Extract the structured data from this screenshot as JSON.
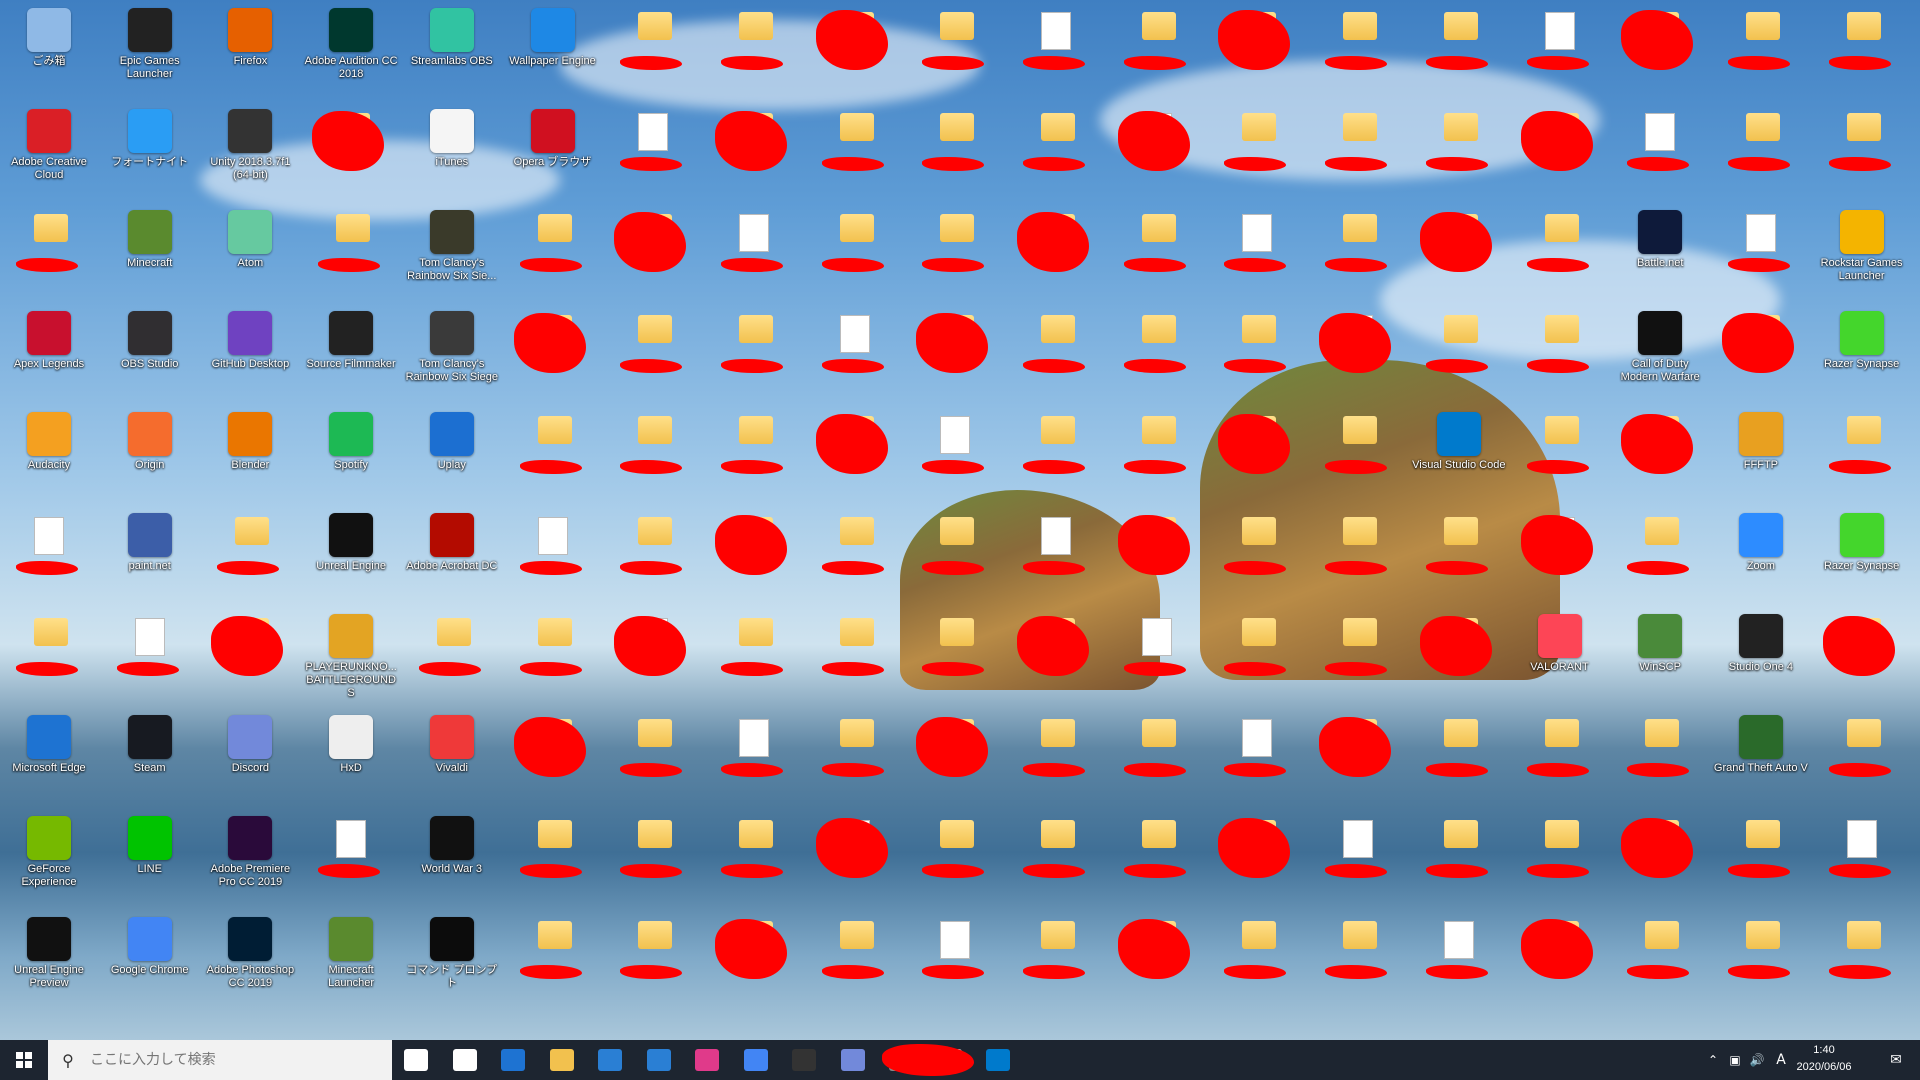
{
  "desktop": {
    "icons": [
      {
        "label": "ごみ箱",
        "icon": "recycle-bin-icon",
        "color": "#8fb9e6"
      },
      {
        "label": "Epic Games Launcher",
        "icon": "epic-games-icon",
        "color": "#222222"
      },
      {
        "label": "Firefox",
        "icon": "firefox-icon",
        "color": "#e66000"
      },
      {
        "label": "Adobe Audition CC 2018",
        "icon": "audition-icon",
        "color": "#00382e"
      },
      {
        "label": "Streamlabs OBS",
        "icon": "streamlabs-icon",
        "color": "#31c3a2"
      },
      {
        "label": "Wallpaper Engine",
        "icon": "wallpaper-engine-icon",
        "color": "#1e88e5"
      },
      {
        "label": "Adobe Creative Cloud",
        "icon": "creative-cloud-icon",
        "color": "#da1f26"
      },
      {
        "label": "フォートナイト",
        "icon": "fortnite-icon",
        "color": "#2a9df4"
      },
      {
        "label": "Unity 2018.3.7f1 (64-bit)",
        "icon": "unity-icon",
        "color": "#333333"
      },
      {
        "label": "iTunes",
        "icon": "itunes-icon",
        "color": "#f5f5f5"
      },
      {
        "label": "Opera ブラウザ",
        "icon": "opera-icon",
        "color": "#d01020"
      },
      {
        "label": "Minecraft",
        "icon": "minecraft-icon",
        "color": "#5a8a2e"
      },
      {
        "label": "Atom",
        "icon": "atom-icon",
        "color": "#66c9a0"
      },
      {
        "label": "Tom Clancy's Rainbow Six Sie...",
        "icon": "rainbow-six-server-icon",
        "color": "#3a3a2a"
      },
      {
        "label": "Battle.net",
        "icon": "battlenet-icon",
        "color": "#0e1a3a"
      },
      {
        "label": "Rockstar Games Launcher",
        "icon": "rockstar-icon",
        "color": "#f4b400"
      },
      {
        "label": "Apex Legends",
        "icon": "apex-icon",
        "color": "#c8102e"
      },
      {
        "label": "OBS Studio",
        "icon": "obs-icon",
        "color": "#302e31"
      },
      {
        "label": "GitHub Desktop",
        "icon": "github-icon",
        "color": "#6f42c1"
      },
      {
        "label": "Source Filmmaker",
        "icon": "sfm-icon",
        "color": "#222222"
      },
      {
        "label": "Tom Clancy's Rainbow Six Siege",
        "icon": "rainbow-six-icon",
        "color": "#3a3a3a"
      },
      {
        "label": "Call of Duty Modern Warfare",
        "icon": "cod-icon",
        "color": "#111111"
      },
      {
        "label": "Razer Synapse",
        "icon": "razer-icon",
        "color": "#44d62c"
      },
      {
        "label": "Audacity",
        "icon": "audacity-icon",
        "color": "#f4a020"
      },
      {
        "label": "Origin",
        "icon": "origin-icon",
        "color": "#f56c2d"
      },
      {
        "label": "Blender",
        "icon": "blender-icon",
        "color": "#ea7600"
      },
      {
        "label": "Spotify",
        "icon": "spotify-icon",
        "color": "#1db954"
      },
      {
        "label": "Uplay",
        "icon": "uplay-icon",
        "color": "#1c6fd1"
      },
      {
        "label": "Visual Studio Code",
        "icon": "vscode-icon",
        "color": "#007acc"
      },
      {
        "label": "FFFTP",
        "icon": "ffftp-icon",
        "color": "#e8a020"
      },
      {
        "label": "paint.net",
        "icon": "paintnet-icon",
        "color": "#3c5ea8"
      },
      {
        "label": "Unreal Engine",
        "icon": "unreal-icon",
        "color": "#111111"
      },
      {
        "label": "Adobe Acrobat DC",
        "icon": "acrobat-icon",
        "color": "#b30b00"
      },
      {
        "label": "Zoom",
        "icon": "zoom-icon",
        "color": "#2d8cff"
      },
      {
        "label": "Razer Synapse",
        "icon": "razer-cloud-icon",
        "color": "#44d62c"
      },
      {
        "label": "PLAYERUNKNO... BATTLEGROUNDS",
        "icon": "pubg-icon",
        "color": "#e3a423"
      },
      {
        "label": "VALORANT",
        "icon": "valorant-icon",
        "color": "#fd4556"
      },
      {
        "label": "WinSCP",
        "icon": "winscp-icon",
        "color": "#4a8a3a"
      },
      {
        "label": "Studio One 4",
        "icon": "studio-one-icon",
        "color": "#222222"
      },
      {
        "label": "Microsoft Edge",
        "icon": "edge-icon",
        "color": "#1e73d2"
      },
      {
        "label": "Steam",
        "icon": "steam-icon",
        "color": "#171a21"
      },
      {
        "label": "Discord",
        "icon": "discord-icon",
        "color": "#7289da"
      },
      {
        "label": "HxD",
        "icon": "hxd-icon",
        "color": "#eeeeee"
      },
      {
        "label": "Vivaldi",
        "icon": "vivaldi-icon",
        "color": "#ef3939"
      },
      {
        "label": "Grand Theft Auto V",
        "icon": "gta-icon",
        "color": "#2a6a2a"
      },
      {
        "label": "GeForce Experience",
        "icon": "geforce-icon",
        "color": "#76b900"
      },
      {
        "label": "LINE",
        "icon": "line-icon",
        "color": "#00c300"
      },
      {
        "label": "Adobe Premiere Pro CC 2019",
        "icon": "premiere-icon",
        "color": "#2a0a3a"
      },
      {
        "label": "World War 3",
        "icon": "ww3-icon",
        "color": "#111111"
      },
      {
        "label": "Unreal Engine Preview",
        "icon": "unreal-preview-icon",
        "color": "#111111"
      },
      {
        "label": "Google Chrome",
        "icon": "chrome-icon",
        "color": "#4285f4"
      },
      {
        "label": "Adobe Photoshop CC 2019",
        "icon": "photoshop-icon",
        "color": "#001d34"
      },
      {
        "label": "Minecraft Launcher",
        "icon": "minecraft-launcher-icon",
        "color": "#5a8a2e"
      },
      {
        "label": "コマンド プロンプト",
        "icon": "cmd-icon",
        "color": "#0c0c0c"
      }
    ]
  },
  "taskbar": {
    "search_placeholder": "ここに入力して検索",
    "apps": [
      {
        "icon": "cortana-icon",
        "color": "#ffffff"
      },
      {
        "icon": "task-view-icon",
        "color": "#ffffff"
      },
      {
        "icon": "edge-icon",
        "color": "#1e73d2"
      },
      {
        "icon": "explorer-icon",
        "color": "#f2c14e"
      },
      {
        "icon": "mail-icon",
        "color": "#2a7fd4"
      },
      {
        "icon": "store-icon",
        "color": "#2a7fd4"
      },
      {
        "icon": "itunes-icon",
        "color": "#e03a8a"
      },
      {
        "icon": "chrome-icon",
        "color": "#4285f4"
      },
      {
        "icon": "terminal-icon",
        "color": "#333333"
      },
      {
        "icon": "discord-icon",
        "color": "#7289da"
      },
      {
        "icon": "app-icon",
        "color": "#888888"
      },
      {
        "icon": "app-icon",
        "color": "#cccccc"
      },
      {
        "icon": "vscode-icon",
        "color": "#007acc"
      }
    ],
    "clock": {
      "time": "1:40",
      "date": "2020/06/06"
    },
    "ime": "A"
  }
}
